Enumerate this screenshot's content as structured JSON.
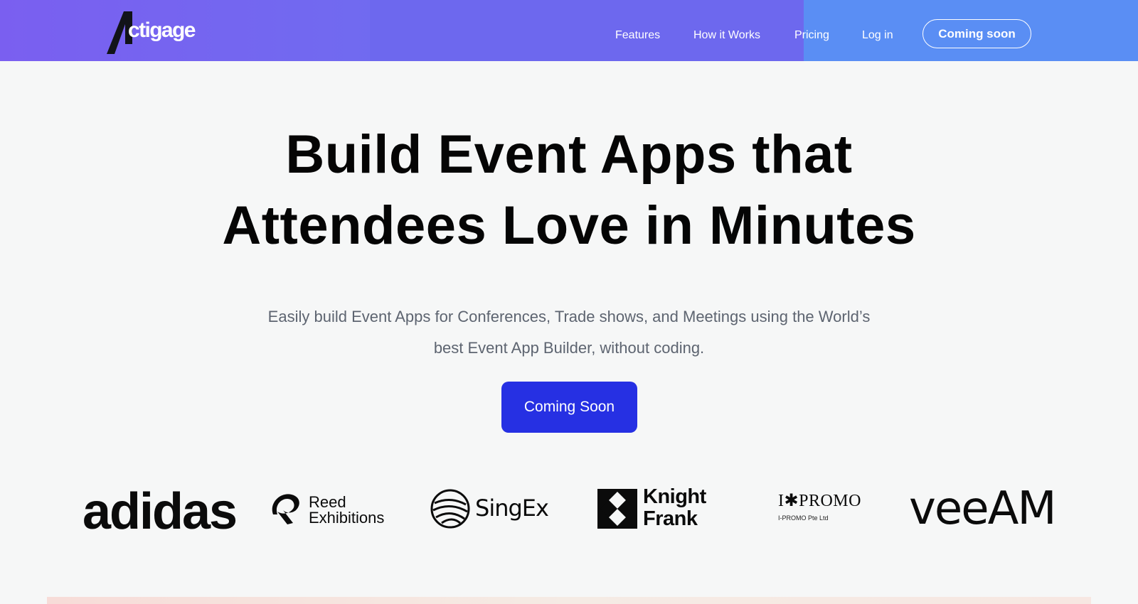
{
  "header": {
    "logo_text": "ctigage",
    "nav": {
      "features": "Features",
      "how_it_works": "How it Works",
      "pricing": "Pricing",
      "login": "Log in",
      "cta": "Coming soon"
    },
    "colors": {
      "gradient_start": "#6f5cf0",
      "gradient_end": "#5b8cf3"
    }
  },
  "hero": {
    "title_line1": "Build Event Apps that",
    "title_line2": "Attendees Love in Minutes",
    "subtitle_line1": "Easily build Event Apps for Conferences, Trade shows, and Meetings using the World’s",
    "subtitle_line2": "best Event App Builder, without coding.",
    "cta": "Coming Soon",
    "cta_color": "#2630e3"
  },
  "brands": {
    "adidas": "adidas",
    "reed_line1": "Reed",
    "reed_line2": "Exhibitions",
    "singex": "SingEx",
    "knight_line1": "Knight",
    "knight_line2": "Frank",
    "ipromo_main": "I✱PROMO",
    "ipromo_sub": "I-PROMO Pte Ltd",
    "veeam": "veeAM"
  }
}
